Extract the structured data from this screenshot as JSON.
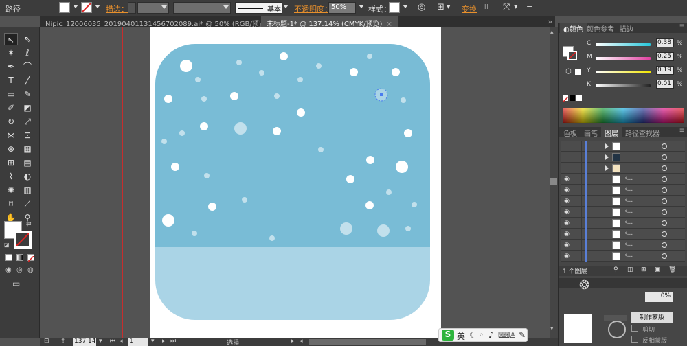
{
  "control_bar": {
    "object_type": "路径",
    "stroke_label": "描边：",
    "stroke_style": "基本",
    "opacity_label": "不透明度：",
    "opacity_value": "50%",
    "style_label": "样式：",
    "transform_label": "变换"
  },
  "tabs": [
    {
      "label": "Nipic_12006035_20190401131456702089.ai* @ 50% (RGB/预览)",
      "close": "×"
    },
    {
      "label": "未标题-1* @ 137.14% (CMYK/预览)",
      "close": "×"
    }
  ],
  "status": {
    "zoom": "137.14",
    "page": "1",
    "tool": "选择"
  },
  "color_panel": {
    "tabs": [
      "颜色",
      "颜色参考",
      "描边"
    ],
    "channels": [
      {
        "label": "C",
        "value": "0.38",
        "unit": "%",
        "color": "#26c6da"
      },
      {
        "label": "M",
        "value": "0.25",
        "unit": "%",
        "color": "#e040a0"
      },
      {
        "label": "Y",
        "value": "0.19",
        "unit": "%",
        "color": "#f2e600"
      },
      {
        "label": "K",
        "value": "0.01",
        "unit": "%",
        "color": "#222222"
      }
    ]
  },
  "layers_panel": {
    "tabs": [
      "色板",
      "画笔",
      "图层",
      "路径查找器"
    ],
    "footer": "1 个图层"
  },
  "bottom_panel": {
    "opacity_value": "0%",
    "make_mask": "制作蒙版",
    "clip": "剪切",
    "invert_mask": "反相蒙版"
  },
  "ime": {
    "logo": "S",
    "lang": "英"
  },
  "artwork": {
    "sky_color": "#79bcd6",
    "ground_color": "#aad4e6",
    "snow_color": "#ffffff"
  }
}
